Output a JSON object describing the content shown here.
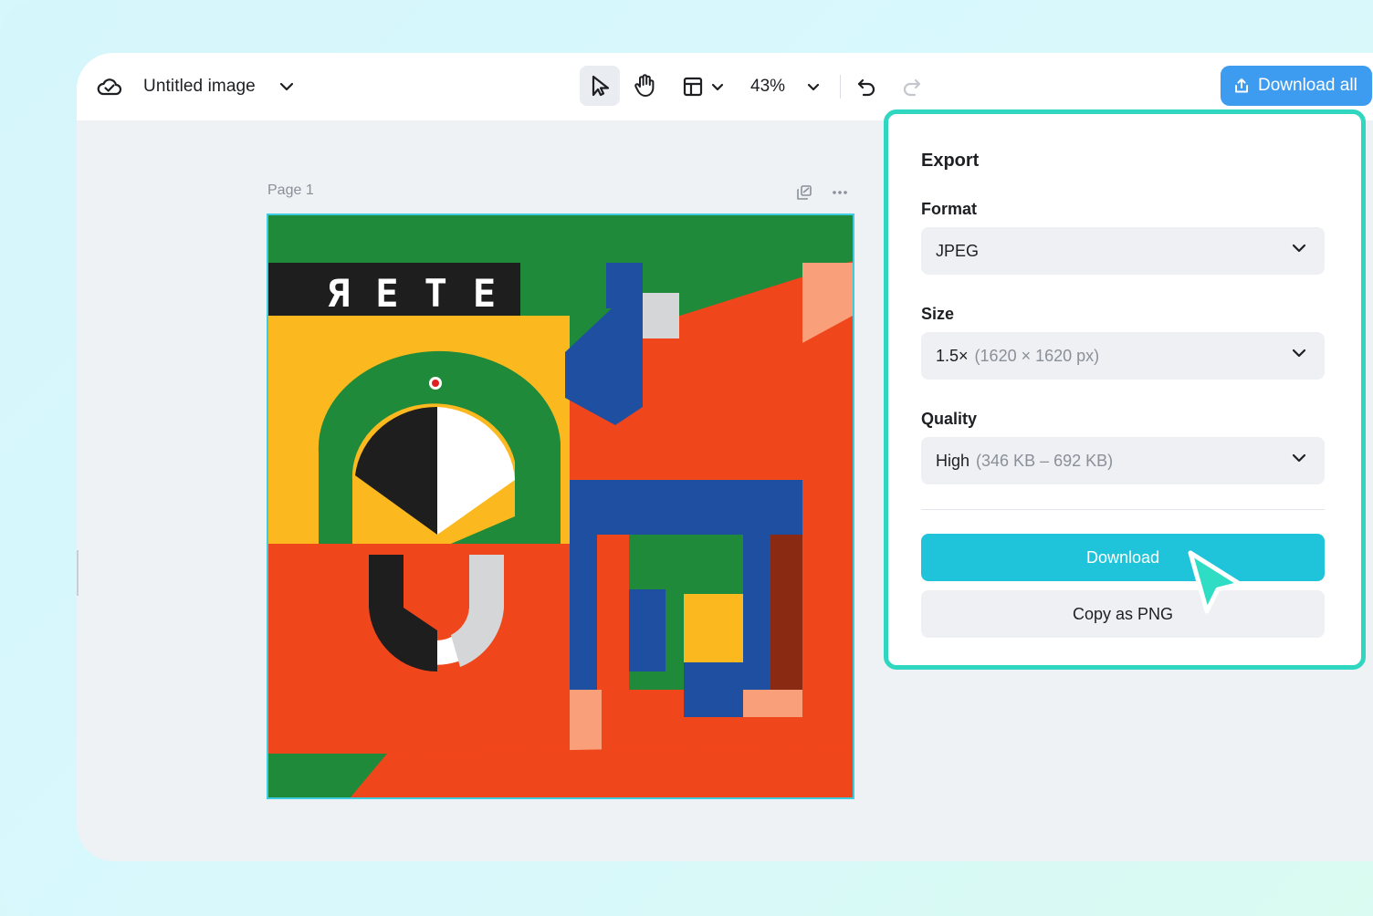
{
  "header": {
    "cloud_icon": "cloud-icon",
    "title": "Untitled image",
    "zoom": "43%",
    "download_all_label": "Download all",
    "tools": [
      "select-cursor-icon",
      "hand-icon",
      "layout-icon",
      "undo-icon",
      "redo-icon"
    ]
  },
  "canvas": {
    "page_label": "Page 1",
    "artwork_text": "ЯETE"
  },
  "export": {
    "title": "Export",
    "format_label": "Format",
    "format_value": "JPEG",
    "size_label": "Size",
    "size_value": "1.5×",
    "size_detail": "(1620 × 1620 px)",
    "quality_label": "Quality",
    "quality_value": "High",
    "quality_detail": "(346 KB – 692 KB)",
    "download_label": "Download",
    "copy_label": "Copy as PNG"
  },
  "colors": {
    "accent": "#20c4da",
    "panel_border": "#2fd6c0",
    "download_all_bg": "#3d9bf0"
  }
}
